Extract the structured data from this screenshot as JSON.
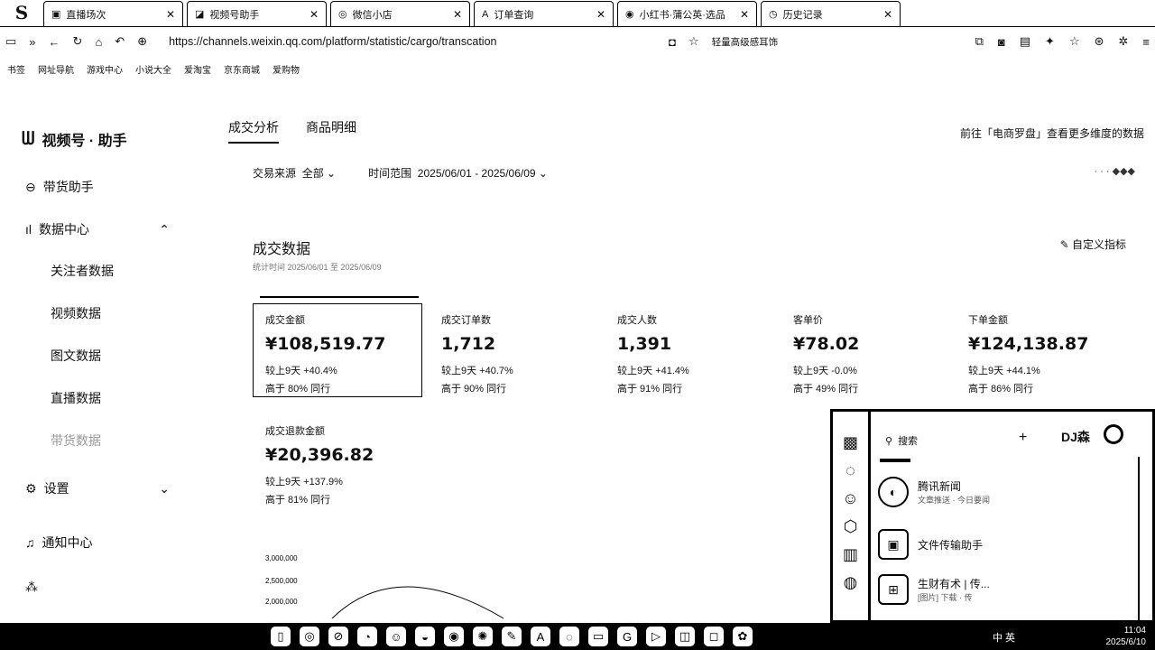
{
  "browser": {
    "tabs": [
      {
        "title": "直播场次"
      },
      {
        "title": "视频号助手"
      },
      {
        "title": "微信小店"
      },
      {
        "title": "订单查询"
      },
      {
        "title": "小红书·蒲公英·选品"
      },
      {
        "title": "历史记录"
      }
    ],
    "url": "https://channels.weixin.qq.com/platform/statistic/cargo/transcation",
    "address_right_text": "轻量高级感耳饰",
    "bookmarks": [
      "书签",
      "网址导航",
      "游戏中心",
      "小说大全",
      "爱淘宝",
      "京东商城",
      "爱购物"
    ]
  },
  "sidebar": {
    "logo": "视频号 · 助手",
    "items": [
      {
        "label": "带货助手"
      },
      {
        "label": "数据中心"
      },
      {
        "label": "关注者数据"
      },
      {
        "label": "视频数据"
      },
      {
        "label": "图文数据"
      },
      {
        "label": "直播数据"
      },
      {
        "label": "带货数据"
      },
      {
        "label": "设置"
      },
      {
        "label": "通知中心"
      }
    ]
  },
  "main": {
    "tabs": [
      "成交分析",
      "商品明细"
    ],
    "right_link": "前往「电商罗盘」查看更多维度的数据",
    "filter_source_label": "交易来源",
    "filter_source_value": "全部",
    "filter_time_label": "时间范围",
    "filter_time_value": "2025/06/01 - 2025/06/09",
    "section_title": "成交数据",
    "section_sub": "统计时间 2025/06/01 至 2025/06/09",
    "custom_metrics": "自定义指标",
    "metrics": [
      {
        "label": "成交金额",
        "value": "¥108,519.77",
        "compare": "较上9天 +40.4%",
        "peer": "高于 80% 同行"
      },
      {
        "label": "成交订单数",
        "value": "1,712",
        "compare": "较上9天 +40.7%",
        "peer": "高于 90% 同行"
      },
      {
        "label": "成交人数",
        "value": "1,391",
        "compare": "较上9天 +41.4%",
        "peer": "高于 91% 同行"
      },
      {
        "label": "客单价",
        "value": "¥78.02",
        "compare": "较上9天 -0.0%",
        "peer": "高于 49% 同行"
      },
      {
        "label": "下单金额",
        "value": "¥124,138.87",
        "compare": "较上9天 +44.1%",
        "peer": "高于 86% 同行"
      },
      {
        "label": "成交退款金额",
        "value": "¥20,396.82",
        "compare": "较上9天 +137.9%",
        "peer": "高于 81% 同行"
      }
    ],
    "chart_ticks": [
      "3,000,000",
      "2,500,000",
      "2,000,000"
    ]
  },
  "chat": {
    "search_placeholder": "搜索",
    "user_name": "DJ森",
    "items": [
      {
        "title": "腾讯新闻",
        "sub": "文章推送 · 今日要闻"
      },
      {
        "title": "文件传输助手",
        "sub": ""
      },
      {
        "title": "生财有术 | 传...",
        "sub": "[图片] 下载 · 传"
      }
    ]
  },
  "taskbar": {
    "tray_label": "中 英",
    "time": "11:04",
    "date": "2025/6/10"
  }
}
